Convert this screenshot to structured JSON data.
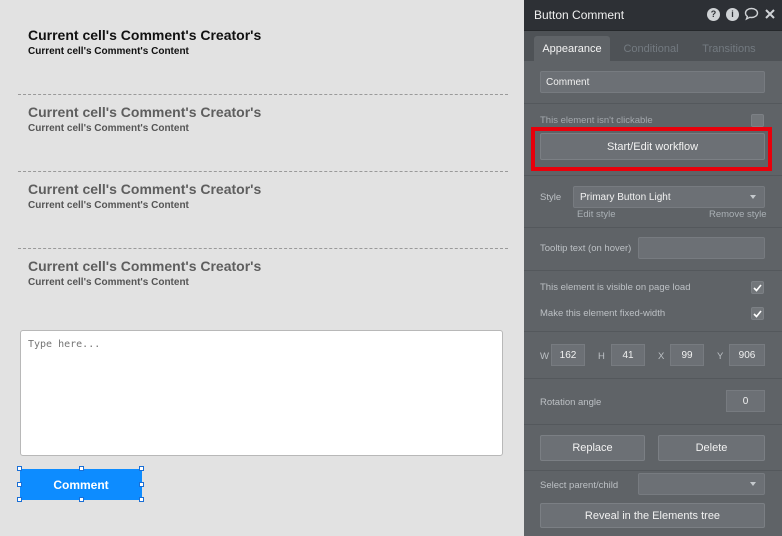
{
  "canvas": {
    "cells": [
      {
        "creator": "Current cell's Comment's Creator's",
        "content": "Current cell's Comment's Content"
      },
      {
        "creator": "Current cell's Comment's Creator's",
        "content": "Current cell's Comment's Content"
      },
      {
        "creator": "Current cell's Comment's Creator's",
        "content": "Current cell's Comment's Content"
      },
      {
        "creator": "Current cell's Comment's Creator's",
        "content": "Current cell's Comment's Content"
      }
    ],
    "input": {
      "placeholder": "Type here..."
    },
    "button": {
      "label": "Comment",
      "color": "#0d8cff"
    }
  },
  "panel": {
    "title": "Button Comment",
    "header_icons": [
      "help-icon",
      "info-icon",
      "comment-bubble-icon",
      "close-icon"
    ],
    "tabs": [
      {
        "label": "Appearance",
        "active": true
      },
      {
        "label": "Conditional",
        "active": false
      },
      {
        "label": "Transitions",
        "active": false
      }
    ],
    "text_value": "Comment",
    "not_clickable_label": "This element isn't clickable",
    "not_clickable_checked": false,
    "workflow_button": "Start/Edit workflow",
    "style_label": "Style",
    "style_value": "Primary Button Light",
    "edit_style": "Edit style",
    "remove_style": "Remove style",
    "tooltip_label": "Tooltip text (on hover)",
    "tooltip_value": "",
    "visible_label": "This element is visible on page load",
    "visible_checked": true,
    "fixed_width_label": "Make this element fixed-width",
    "fixed_width_checked": true,
    "dims": {
      "w_label": "W",
      "w_value": "162",
      "h_label": "H",
      "h_value": "41",
      "x_label": "X",
      "x_value": "99",
      "y_label": "Y",
      "y_value": "906"
    },
    "rotation_label": "Rotation angle",
    "rotation_value": "0",
    "replace_button": "Replace",
    "delete_button": "Delete",
    "parent_label": "Select parent/child",
    "parent_value": "",
    "reveal_button": "Reveal in the Elements tree",
    "highlight_color": "#e8000b"
  }
}
